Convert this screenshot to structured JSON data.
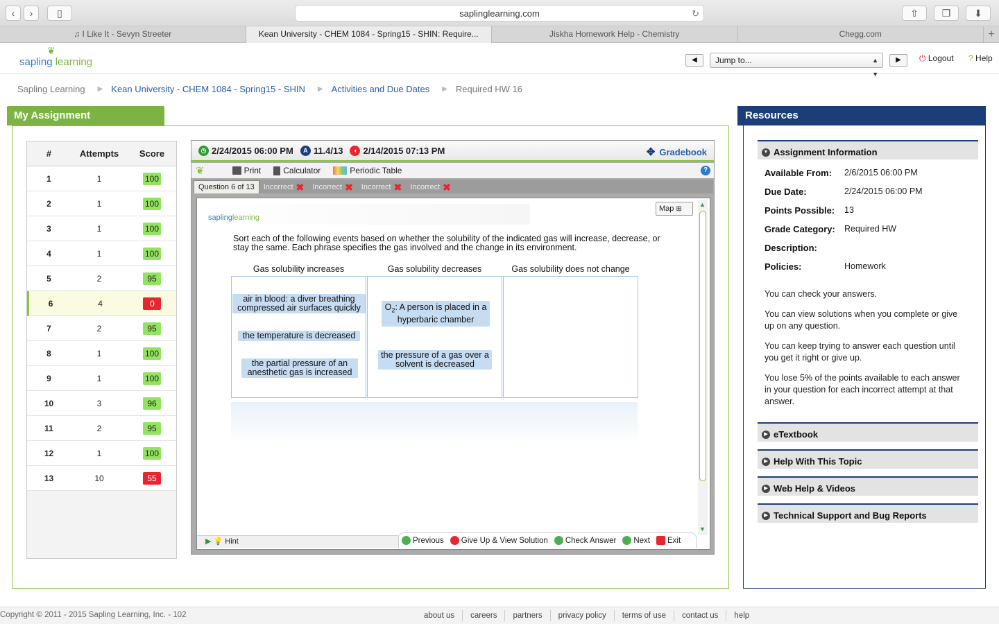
{
  "browser": {
    "url": "saplinglearning.com",
    "tabs": [
      "♫ I Like It - Sevyn Streeter",
      "Kean University - CHEM 1084 - Spring15 - SHIN: Require...",
      "Jiskha Homework Help - Chemistry",
      "Chegg.com"
    ],
    "new_tab": "+"
  },
  "header": {
    "logo_a": "sapling",
    "logo_b": "learning",
    "jump_to": "Jump to...",
    "logout": "Logout",
    "help": "Help"
  },
  "breadcrumb": [
    "Sapling Learning",
    "Kean University - CHEM 1084 - Spring15 - SHIN",
    "Activities and Due Dates",
    "Required HW 16"
  ],
  "assignment": {
    "title": "My Assignment",
    "columns": [
      "#",
      "Attempts",
      "Score"
    ],
    "rows": [
      {
        "n": "1",
        "attempts": "1",
        "score": "100",
        "status": "green"
      },
      {
        "n": "2",
        "attempts": "1",
        "score": "100",
        "status": "green"
      },
      {
        "n": "3",
        "attempts": "1",
        "score": "100",
        "status": "green"
      },
      {
        "n": "4",
        "attempts": "1",
        "score": "100",
        "status": "green"
      },
      {
        "n": "5",
        "attempts": "2",
        "score": "95",
        "status": "green"
      },
      {
        "n": "6",
        "attempts": "4",
        "score": "0",
        "status": "red"
      },
      {
        "n": "7",
        "attempts": "2",
        "score": "95",
        "status": "green"
      },
      {
        "n": "8",
        "attempts": "1",
        "score": "100",
        "status": "green"
      },
      {
        "n": "9",
        "attempts": "1",
        "score": "100",
        "status": "green"
      },
      {
        "n": "10",
        "attempts": "3",
        "score": "96",
        "status": "green"
      },
      {
        "n": "11",
        "attempts": "2",
        "score": "95",
        "status": "green"
      },
      {
        "n": "12",
        "attempts": "1",
        "score": "100",
        "status": "green"
      },
      {
        "n": "13",
        "attempts": "10",
        "score": "55",
        "status": "red"
      }
    ]
  },
  "question": {
    "due": "2/24/2015 06:00 PM",
    "score": "11.4/13",
    "last": "2/14/2015 07:13 PM",
    "gradebook": "Gradebook",
    "tools": [
      "Print",
      "Calculator",
      "Periodic Table"
    ],
    "tab_current": "Question 6 of 13",
    "tab_attempt": "Incorrect",
    "map": "Map",
    "prompt": "Sort each of the following events based on whether the solubility of the indicated gas will increase, decrease, or stay the same. Each phrase specifies the gas involved and the change in its environment.",
    "col_increase": "Gas solubility increases",
    "col_decrease": "Gas solubility decreases",
    "col_nochange": "Gas solubility does not change",
    "chip_diver": "air in blood: a diver breathing compressed air surfaces quickly",
    "chip_temp": "the temperature is decreased",
    "chip_anesthetic": "the partial pressure of an anesthetic gas is increased",
    "chip_o2_a": "O",
    "chip_o2_sub": "2",
    "chip_o2_b": ": A person is placed in a hyperbaric chamber",
    "chip_solvent": "the pressure of a gas over a solvent is decreased",
    "hint": "Hint",
    "nav": [
      "Previous",
      "Give Up & View Solution",
      "Check Answer",
      "Next",
      "Exit"
    ]
  },
  "resources": {
    "title": "Resources",
    "section_info": "Assignment Information",
    "info": [
      {
        "label": "Available From:",
        "value": "2/6/2015 06:00 PM"
      },
      {
        "label": "Due Date:",
        "value": "2/24/2015 06:00 PM"
      },
      {
        "label": "Points Possible:",
        "value": "13"
      },
      {
        "label": "Grade Category:",
        "value": "Required HW"
      },
      {
        "label": "Description:",
        "value": ""
      },
      {
        "label": "Policies:",
        "value": "Homework"
      }
    ],
    "policies": [
      "You can check your answers.",
      "You can view solutions when you complete or give up on any question.",
      "You can keep trying to answer each question until you get it right or give up.",
      "You lose 5% of the points available to each answer in your question for each incorrect attempt at that answer."
    ],
    "sections": [
      "eTextbook",
      "Help With This Topic",
      "Web Help & Videos",
      "Technical Support and Bug Reports"
    ]
  },
  "footer": {
    "copyright": "Copyright © 2011 - 2015 Sapling Learning, Inc. - 102",
    "links": [
      "about us",
      "careers",
      "partners",
      "privacy policy",
      "terms of use",
      "contact us",
      "help"
    ]
  },
  "colors": {
    "brand_green": "#7cb342",
    "brand_blue": "#1b3e78",
    "score_green": "#92e35f",
    "score_red": "#e8262f"
  }
}
